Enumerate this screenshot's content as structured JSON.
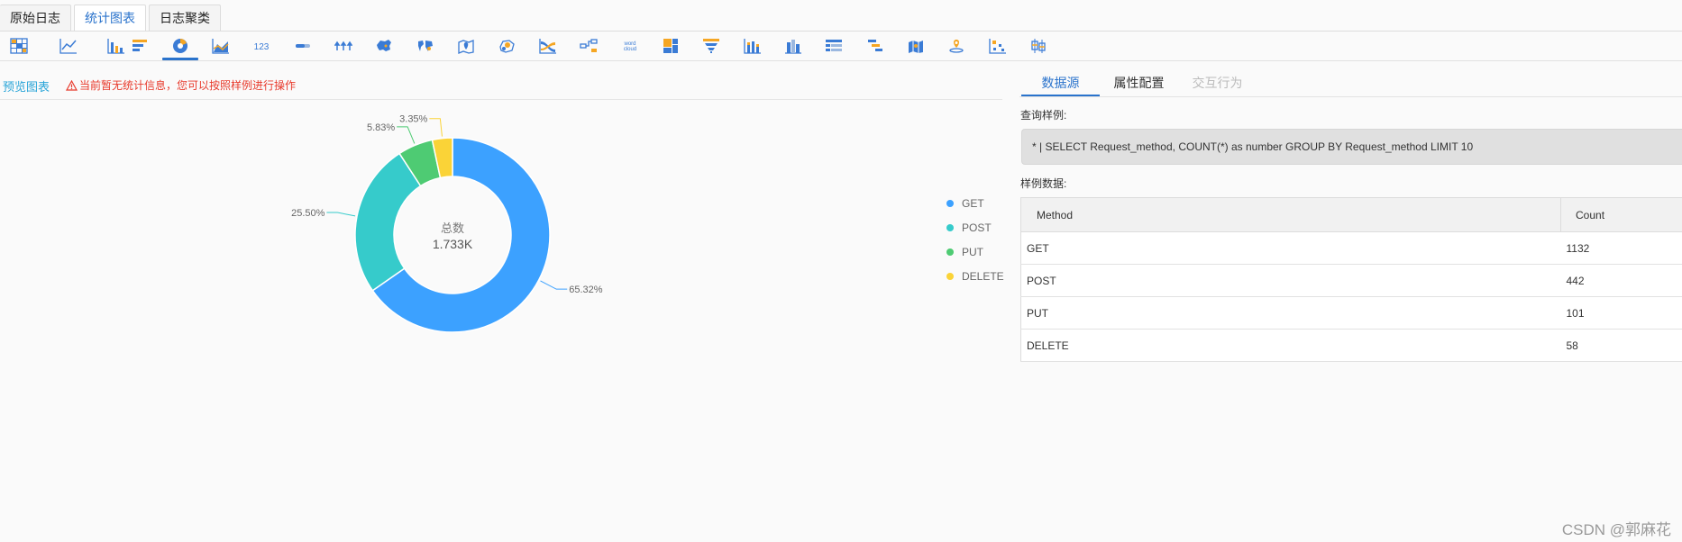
{
  "top_tabs": [
    "原始日志",
    "统计图表",
    "日志聚类"
  ],
  "active_tab": 1,
  "toolbar": {
    "icons": [
      "table-icon",
      "line-chart-icon",
      "bar-chart-icon",
      "horizontal-bar-icon",
      "pie-chart-icon",
      "area-chart-icon",
      "number-icon",
      "progress-bar-icon",
      "flow-icon",
      "china-map-icon",
      "world-map-icon",
      "map-pin-icon",
      "bubble-map-icon",
      "sankey-icon",
      "tree-icon",
      "word-cloud-icon",
      "treemap-icon",
      "funnel-icon",
      "stacked-bar-icon",
      "column-icon",
      "list-table-icon",
      "gantt-icon",
      "city-map-icon",
      "location-icon",
      "scatter-icon",
      "box-plot-icon"
    ],
    "labels": {
      "number": "123",
      "word_cloud": "word cloud"
    },
    "active_index": 4
  },
  "preview": {
    "title": "预览图表",
    "warning": "当前暂无统计信息，您可以按照样例进行操作"
  },
  "chart_data": {
    "type": "pie",
    "center_label": "总数",
    "center_value": "1.733K",
    "categories": [
      "GET",
      "POST",
      "PUT",
      "DELETE"
    ],
    "values": [
      1132,
      442,
      101,
      58
    ],
    "percent_labels": [
      "65.32%",
      "25.50%",
      "5.83%",
      "3.35%"
    ],
    "colors": [
      "#3ca1ff",
      "#36cbcb",
      "#4ecb73",
      "#fad337"
    ],
    "legend_position": "right"
  },
  "right_panel": {
    "tabs": [
      "数据源",
      "属性配置",
      "交互行为"
    ],
    "query_label": "查询样例:",
    "query": "* | SELECT Request_method, COUNT(*) as number GROUP BY Request_method LIMIT 10",
    "sample_label": "样例数据:",
    "table": {
      "headers": [
        "Method",
        "Count"
      ],
      "rows": [
        [
          "GET",
          "1132"
        ],
        [
          "POST",
          "442"
        ],
        [
          "PUT",
          "101"
        ],
        [
          "DELETE",
          "58"
        ]
      ]
    }
  },
  "watermark": "CSDN @郭麻花"
}
